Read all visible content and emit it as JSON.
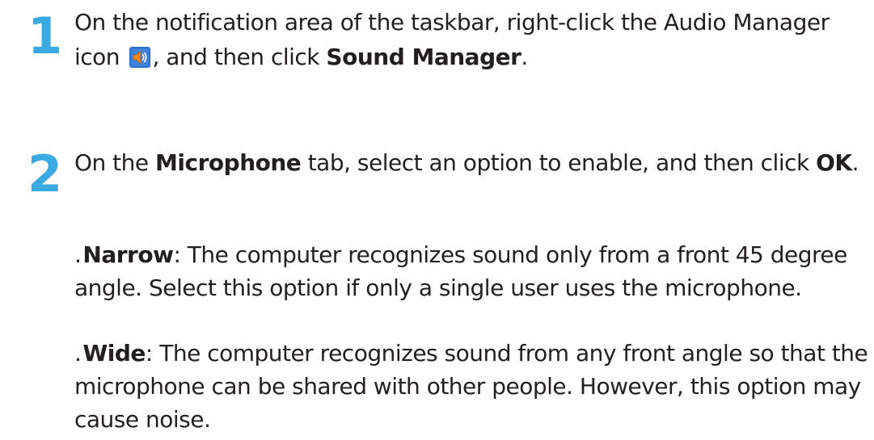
{
  "steps": [
    {
      "number": "1",
      "text_before_icon": "On the notification area of the taskbar, right-click the Audio Manager icon",
      "icon": "speaker-volume-icon",
      "text_after_icon": ", and then click ",
      "bold_target": "Sound Manager",
      "text_end": "."
    },
    {
      "number": "2",
      "text_start": "On the ",
      "bold_tab": "Microphone",
      "text_mid": " tab, select an option to enable, and then click ",
      "bold_ok": "OK",
      "text_end": "."
    }
  ],
  "options": [
    {
      "bullet": ".",
      "name": "Narrow",
      "description": ": The computer recognizes sound only from a front 45 degree angle. Select this option if only a single user uses the microphone."
    },
    {
      "bullet": ".",
      "name": "Wide",
      "description": ": The computer recognizes sound from any front angle so that the microphone can be shared with other people. However, this option may cause noise."
    }
  ],
  "colors": {
    "step_number": "#3ba9e2",
    "body_text": "#231f20",
    "icon_background": "#2f6fd0",
    "icon_speaker": "#f08a24"
  }
}
